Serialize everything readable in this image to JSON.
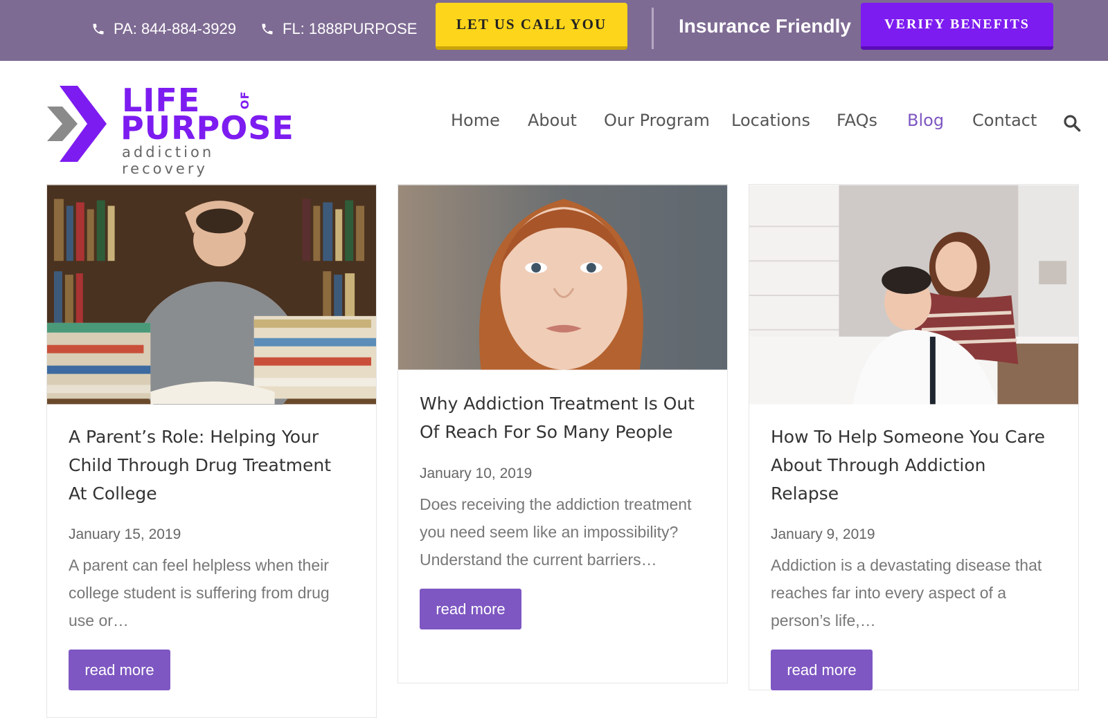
{
  "topbar": {
    "phone_pa": "PA: 844-884-3929",
    "phone_fl": "FL: 1888PURPOSE",
    "call_button": "LET US CALL YOU",
    "insurance_text": "Insurance Friendly",
    "verify_button": "VERIFY BENEFITS"
  },
  "logo": {
    "line1": "LIFE",
    "of": "OF",
    "line2": "PURPOSE",
    "tagline": "addiction recovery"
  },
  "nav": {
    "items": [
      {
        "label": "Home"
      },
      {
        "label": "About"
      },
      {
        "label": "Our Program"
      },
      {
        "label": "Locations"
      },
      {
        "label": "FAQs"
      },
      {
        "label": "Blog",
        "active": true
      },
      {
        "label": "Contact"
      }
    ]
  },
  "posts": [
    {
      "title": "A Parent’s Role: Helping Your Child Through Drug Treatment At College",
      "date": "January 15, 2019",
      "excerpt": "A parent can feel helpless when their college student is suffering from drug use or…",
      "button": "read more"
    },
    {
      "title": "Why Addiction Treatment Is Out Of Reach For So Many People",
      "date": "January 10, 2019",
      "excerpt": "Does receiving the addiction treatment you need seem like an impossibility? Understand the current barriers…",
      "button": "read more"
    },
    {
      "title": "How To Help Someone You Care About Through Addiction Relapse",
      "date": "January 9, 2019",
      "excerpt": "Addiction is a devastating disease that reaches far into every aspect of a person’s life,…",
      "button": "read more"
    }
  ],
  "colors": {
    "topbar": "#7e6b93",
    "call_button": "#fdd51a",
    "verify_button": "#7d1cf0",
    "accent": "#7e57c2",
    "logo": "#7d1cf0"
  }
}
